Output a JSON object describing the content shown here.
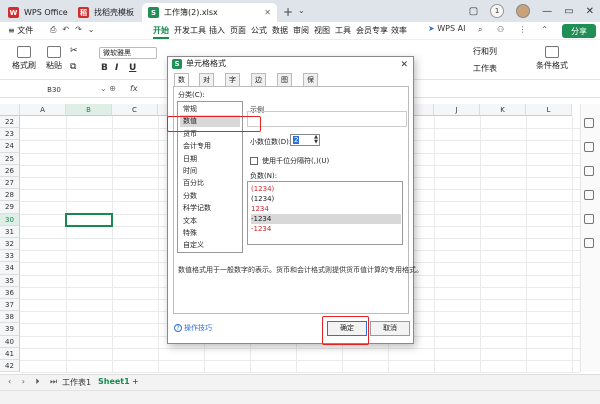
{
  "titlebar": {
    "tabs": [
      {
        "label": "WPS Office",
        "icon_color": "#d12d2d",
        "icon_glyph": "W"
      },
      {
        "label": "找稻壳模板",
        "icon_color": "#d12d2d",
        "icon_glyph": "稻"
      },
      {
        "label": "工作簿(2).xlsx",
        "icon_color": "#1f8f55",
        "icon_glyph": "S"
      }
    ],
    "plus": "+",
    "chevron": "⌄",
    "counter": "1"
  },
  "menubar": {
    "file": "≡ 文件",
    "items": [
      "开始",
      "开发工具",
      "插入",
      "页面",
      "公式",
      "数据",
      "审阅",
      "视图",
      "工具",
      "会员专享",
      "效率"
    ],
    "active": "开始",
    "ai": "WPS AI",
    "share": "分享"
  },
  "ribbon": {
    "format_painter": "格式刷",
    "paste": "粘贴",
    "font": "微软雅黑",
    "bold": "B",
    "italic": "I",
    "underline": "U",
    "rows_cols": "行和列",
    "worksheet": "工作表",
    "conditional": "条件格式"
  },
  "formula": {
    "cell_ref": "B30",
    "fx": "fx"
  },
  "grid": {
    "columns": [
      "A",
      "B",
      "C",
      "D",
      "E",
      "F",
      "G",
      "H",
      "I",
      "J",
      "K",
      "L"
    ],
    "rows": [
      "22",
      "23",
      "24",
      "25",
      "26",
      "27",
      "28",
      "29",
      "30",
      "31",
      "32",
      "33",
      "34",
      "35",
      "36",
      "37",
      "38",
      "39",
      "40",
      "41",
      "42"
    ],
    "selected_col": "B",
    "selected_row": "30"
  },
  "sheets": {
    "tabs": [
      "工作表1",
      "Sheet1"
    ],
    "active": "Sheet1",
    "add": "+"
  },
  "dialog": {
    "title": "单元格格式",
    "tabs": [
      "数字",
      "对齐",
      "字体",
      "边框",
      "图案",
      "保护"
    ],
    "active_tab": "数字",
    "category_label": "分类(C):",
    "categories": [
      "常规",
      "数值",
      "货币",
      "会计专用",
      "日期",
      "时间",
      "百分比",
      "分数",
      "科学记数",
      "文本",
      "特殊",
      "自定义"
    ],
    "selected_category": "数值",
    "sample_label": "示例",
    "decimal_label": "小数位数(D):",
    "decimal_value": "2",
    "thousands_label": "使用千位分隔符(,)(U)",
    "negative_label": "负数(N):",
    "negative_formats": [
      {
        "text": "(1234)",
        "red": true
      },
      {
        "text": "(1234)",
        "red": false
      },
      {
        "text": "1234",
        "red": true
      },
      {
        "text": "-1234",
        "red": false
      },
      {
        "text": "-1234",
        "red": true
      }
    ],
    "description": "数值格式用于一般数字的表示。货币和会计格式则提供货币值计算的专用格式。",
    "help": "操作技巧",
    "ok": "确定",
    "cancel": "取消"
  },
  "colors": {
    "accent": "#188a4f",
    "highlight": "#e02424",
    "negative_red": "#d0282d"
  }
}
